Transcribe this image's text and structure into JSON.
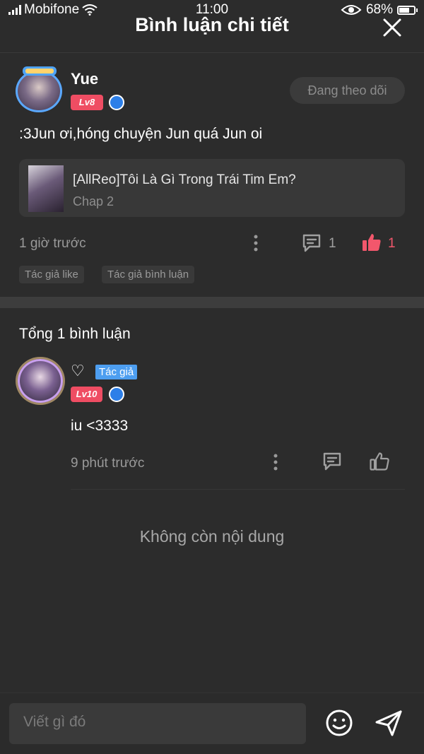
{
  "status_bar": {
    "carrier": "Mobifone",
    "time": "11:00",
    "battery": "68%",
    "battery_level": 0.68
  },
  "header": {
    "title": "Bình luận chi tiết"
  },
  "main_comment": {
    "username": "Yue",
    "level": "Lv8",
    "follow_label": "Đang theo dõi",
    "text": ":3Jun ơi,hóng chuyện Jun quá Jun oi",
    "story": {
      "title": "[AllReo]Tôi Là Gì Trong Trái Tim Em?",
      "chapter": "Chap 2"
    },
    "time": "1 giờ trước",
    "reply_count": "1",
    "like_count": "1",
    "tags": [
      "Tác giả like",
      "Tác giả bình luận"
    ]
  },
  "replies_section": {
    "total_label": "Tổng 1 bình luận",
    "reply": {
      "username": "♡",
      "author_badge": "Tác giả",
      "level": "Lv10",
      "text": "iu <3333",
      "time": "9 phút trước"
    },
    "end_text": "Không còn nội dung"
  },
  "composer": {
    "placeholder": "Viết gì đó"
  },
  "colors": {
    "background": "#2c2c2c",
    "level_badge": "#ef4d63",
    "author_badge": "#4d9ef0",
    "like_active": "#f2576c",
    "vip_badge": "#2d7fe8"
  },
  "icons": {
    "close": "close-icon",
    "more": "more-vertical-icon",
    "reply": "comment-icon",
    "like": "thumbs-up-icon",
    "emoji": "emoji-icon",
    "send": "send-icon"
  }
}
